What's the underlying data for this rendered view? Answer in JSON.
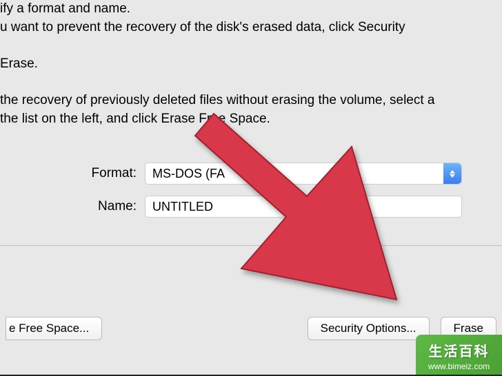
{
  "instructions": {
    "line1": "ify a format and name.",
    "line2": "u want to prevent the recovery of the disk's erased data, click Security",
    "line3": " Erase.",
    "line4": " the recovery of previously deleted files without erasing the volume, select a",
    "line5": "the list on the left, and click Erase Free Space."
  },
  "form": {
    "format_label": "Format:",
    "format_value": "MS-DOS (FA",
    "name_label": "Name:",
    "name_value": "UNTITLED"
  },
  "buttons": {
    "erase_free_space": "e Free Space...",
    "security_options": "Security Options...",
    "erase": "Frase"
  },
  "watermark": {
    "title": "生活百科",
    "url": "www.bimeiz.com"
  }
}
